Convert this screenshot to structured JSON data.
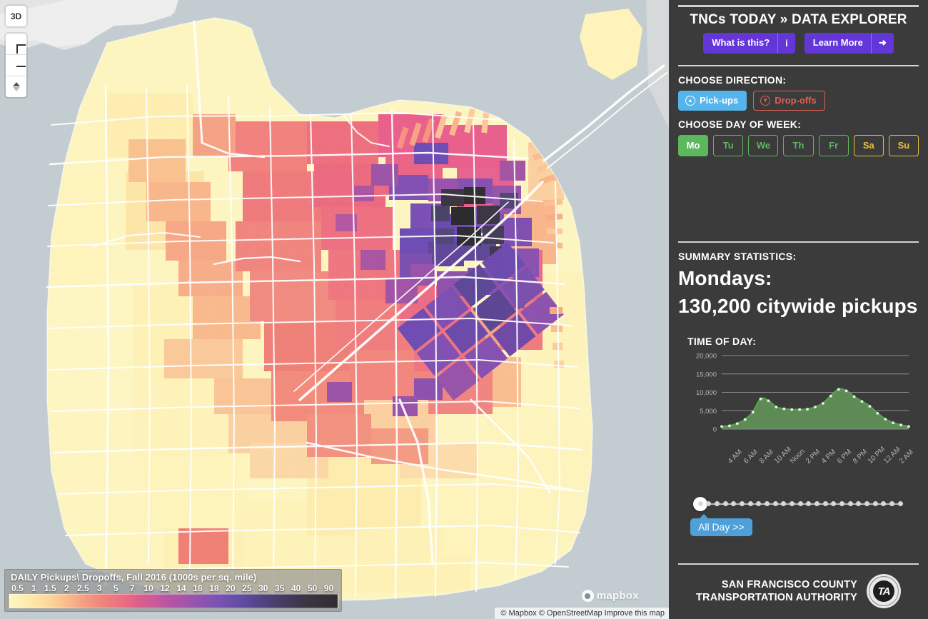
{
  "sidebar": {
    "app_title": "TNCs TODAY » DATA EXPLORER",
    "header_buttons": [
      {
        "label": "What is this?",
        "icon": "info-icon",
        "glyph": "i"
      },
      {
        "label": "Learn More",
        "icon": "arrow-right-icon",
        "glyph": "➜"
      }
    ],
    "direction": {
      "label": "CHOOSE DIRECTION:",
      "options": [
        {
          "label": "Pick-ups",
          "icon": "arrow-up-circle-icon",
          "glyph": "▲",
          "selected": true
        },
        {
          "label": "Drop-offs",
          "icon": "arrow-down-circle-icon",
          "glyph": "▼",
          "selected": false
        }
      ]
    },
    "day_of_week": {
      "label": "CHOOSE DAY OF WEEK:",
      "days": [
        {
          "label": "Mo",
          "kind": "weekday",
          "selected": true
        },
        {
          "label": "Tu",
          "kind": "weekday",
          "selected": false
        },
        {
          "label": "We",
          "kind": "weekday",
          "selected": false
        },
        {
          "label": "Th",
          "kind": "weekday",
          "selected": false
        },
        {
          "label": "Fr",
          "kind": "weekday",
          "selected": false
        },
        {
          "label": "Sa",
          "kind": "weekend",
          "selected": false
        },
        {
          "label": "Su",
          "kind": "weekend",
          "selected": false
        }
      ]
    },
    "summary": {
      "label": "SUMMARY STATISTICS:",
      "day_line": "Mondays:",
      "total_line": "130,200 citywide pickups"
    },
    "time_of_day_label": "TIME OF DAY:",
    "slider": {
      "position_index": 0,
      "ticks": 25,
      "all_day_label": "All Day >>"
    },
    "footer": {
      "agency_line1": "SAN FRANCISCO COUNTY",
      "agency_line2": "TRANSPORTATION AUTHORITY",
      "seal_initials": "TA",
      "seal_text": "SAN FRANCISCO COUNTY TRANSPORTATION AUTHORITY"
    },
    "colors": {
      "accent_purple": "#6336d8",
      "pickup_blue": "#56b4ec",
      "dropoff_red": "#e2614f",
      "weekday_green": "#5cb85c",
      "weekend_yellow": "#e8c13a",
      "panel_bg": "#3b3b3b",
      "slider_blue": "#4f9fd8"
    }
  },
  "map": {
    "controls": [
      {
        "name": "3d-toggle",
        "label": "3D"
      },
      {
        "name": "zoom-in",
        "label": "+"
      },
      {
        "name": "zoom-out",
        "label": "−"
      },
      {
        "name": "compass",
        "label": ""
      }
    ],
    "legend": {
      "title": "DAILY Pickups\\ Dropoffs, Fall 2016 (1000s per sq. mile)",
      "ticks": [
        "0.5",
        "1",
        "1.5",
        "2",
        "2.5",
        "3",
        "5",
        "7",
        "10",
        "12",
        "14",
        "16",
        "18",
        "20",
        "25",
        "30",
        "35",
        "40",
        "50",
        "90"
      ]
    },
    "brand": "mapbox",
    "attribution": "© Mapbox © OpenStreetMap Improve this map",
    "water_color": "#c3ccd1",
    "land_color": "#e8e8e8"
  },
  "chart_data": {
    "type": "area",
    "title": "TIME OF DAY:",
    "xlabel": "",
    "ylabel": "",
    "ylim": [
      0,
      20000
    ],
    "yticks": [
      0,
      5000,
      10000,
      15000,
      20000
    ],
    "ytick_labels": [
      "0",
      "5,000",
      "10,000",
      "15,000",
      "20,000"
    ],
    "xtick_labels": [
      "4 AM",
      "6 AM",
      "8 AM",
      "10 AM",
      "Noon",
      "2 PM",
      "4 PM",
      "6 PM",
      "8 PM",
      "10 PM",
      "12 AM",
      "2 AM"
    ],
    "grid": true,
    "legend": "none",
    "line_color": "#54a24b",
    "fill_color": "#5d8a55",
    "x": [
      "3 AM",
      "4 AM",
      "5 AM",
      "6 AM",
      "7 AM",
      "8 AM",
      "9 AM",
      "10 AM",
      "11 AM",
      "Noon",
      "1 PM",
      "2 PM",
      "3 PM",
      "4 PM",
      "5 PM",
      "6 PM",
      "7 PM",
      "8 PM",
      "9 PM",
      "10 PM",
      "11 PM",
      "12 AM",
      "1 AM",
      "2 AM",
      "3 AM"
    ],
    "series": [
      {
        "name": "Monday citywide pickups",
        "values": [
          700,
          900,
          1500,
          2600,
          4600,
          8200,
          7700,
          6000,
          5500,
          5300,
          5300,
          5400,
          6000,
          7000,
          9000,
          10800,
          10400,
          8800,
          7500,
          6200,
          4300,
          2700,
          1700,
          1100,
          700
        ]
      }
    ]
  }
}
